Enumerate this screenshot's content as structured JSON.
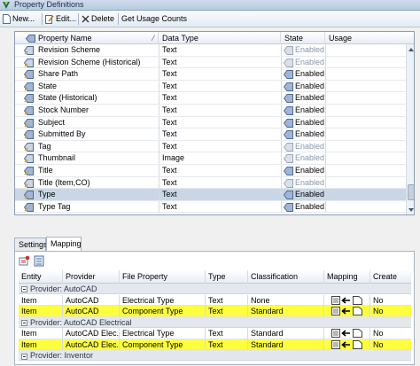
{
  "window": {
    "title": "Property Definitions"
  },
  "toolbar": {
    "new_label": "New...",
    "edit_label": "Edit...",
    "delete_label": "Delete",
    "usage_label": "Get Usage Counts"
  },
  "properties": {
    "columns": [
      "Property Name",
      "Data Type",
      "State",
      "Usage"
    ],
    "rows": [
      {
        "name": "Revision Scheme",
        "type": "Text",
        "state": "Enabled",
        "dim": true
      },
      {
        "name": "Revision Scheme (Historical)",
        "type": "Text",
        "state": "Enabled",
        "dim": true
      },
      {
        "name": "Share Path",
        "type": "Text",
        "state": "Enabled",
        "dim": false
      },
      {
        "name": "State",
        "type": "Text",
        "state": "Enabled",
        "dim": false
      },
      {
        "name": "State (Historical)",
        "type": "Text",
        "state": "Enabled",
        "dim": false
      },
      {
        "name": "Stock Number",
        "type": "Text",
        "state": "Enabled",
        "dim": false
      },
      {
        "name": "Subject",
        "type": "Text",
        "state": "Enabled",
        "dim": false
      },
      {
        "name": "Submitted By",
        "type": "Text",
        "state": "Enabled",
        "dim": false
      },
      {
        "name": "Tag",
        "type": "Text",
        "state": "Enabled",
        "dim": true
      },
      {
        "name": "Thumbnail",
        "type": "Image",
        "state": "Enabled",
        "dim": true
      },
      {
        "name": "Title",
        "type": "Text",
        "state": "Enabled",
        "dim": false
      },
      {
        "name": "Title (Item,CO)",
        "type": "Text",
        "state": "Enabled",
        "dim": true
      },
      {
        "name": "Type",
        "type": "Text",
        "state": "Enabled",
        "dim": false,
        "selected": true
      },
      {
        "name": "Type Tag",
        "type": "Text",
        "state": "Enabled",
        "dim": false
      }
    ]
  },
  "tabs": [
    "Settings",
    "Mapping"
  ],
  "mapping": {
    "columns": [
      "Entity",
      "Provider",
      "File Property",
      "Type",
      "Classification",
      "Mapping",
      "Create"
    ],
    "groups": [
      {
        "label": "Provider: AutoCAD",
        "rows": [
          {
            "entity": "Item",
            "provider": "AutoCAD",
            "file_property": "Electrical Type",
            "type": "Text",
            "classification": "None",
            "create": "No",
            "hl": false
          },
          {
            "entity": "Item",
            "provider": "AutoCAD",
            "file_property": "Component Type",
            "type": "Text",
            "classification": "Standard",
            "create": "No",
            "hl": true
          }
        ]
      },
      {
        "label": "Provider: AutoCAD Electrical",
        "rows": [
          {
            "entity": "Item",
            "provider": "AutoCAD Elec...",
            "file_property": "Electrical Type",
            "type": "Text",
            "classification": "Standard",
            "create": "No",
            "hl": false
          },
          {
            "entity": "Item",
            "provider": "AutoCAD Elec...",
            "file_property": "Component Type",
            "type": "Text",
            "classification": "Standard",
            "create": "No",
            "hl": true
          }
        ]
      },
      {
        "label": "Provider: Inventor",
        "rows": []
      }
    ]
  }
}
